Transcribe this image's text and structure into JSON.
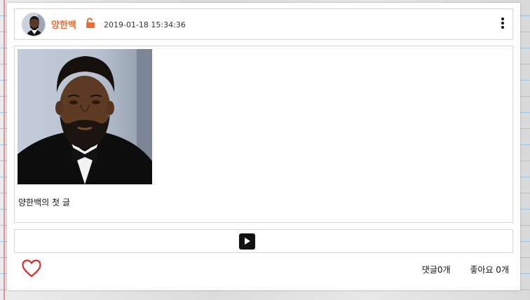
{
  "post": {
    "author": "양한백",
    "date": "2019-01-18 15:34:36",
    "text": "양한백의 첫 글"
  },
  "footer": {
    "comments": "댓글0개",
    "likes": "좋아요 0개"
  },
  "icons": {
    "lock": "unlock-icon",
    "menu": "more-vertical-icon",
    "play": "play-icon",
    "like": "heart-icon"
  },
  "colors": {
    "accent": "#ec6b31",
    "heart": "#e02a2a"
  }
}
